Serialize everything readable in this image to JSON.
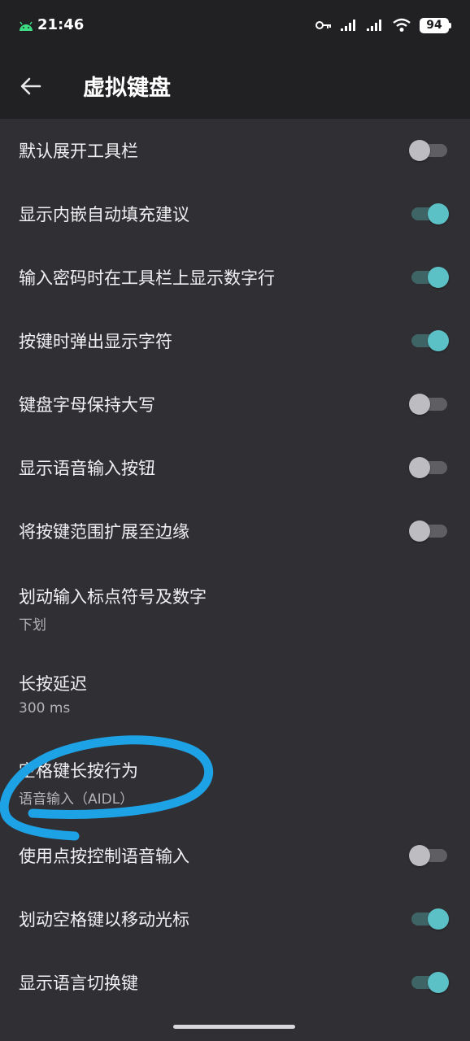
{
  "status_bar": {
    "time": "21:46",
    "battery": "94",
    "icons": [
      "android-icon",
      "key-icon",
      "signal-icon",
      "signal-icon",
      "wifi-icon",
      "battery-icon"
    ]
  },
  "app_bar": {
    "title": "虚拟键盘",
    "back_icon": "arrow-left-icon"
  },
  "colors": {
    "background": "#302f33",
    "bar": "#212023",
    "accent": "#5cc1c6",
    "annotation": "#1ea2e6"
  },
  "settings": [
    {
      "title": "默认展开工具栏",
      "type": "toggle",
      "on": false
    },
    {
      "title": "显示内嵌自动填充建议",
      "type": "toggle",
      "on": true
    },
    {
      "title": "输入密码时在工具栏上显示数字行",
      "type": "toggle",
      "on": true
    },
    {
      "title": "按键时弹出显示字符",
      "type": "toggle",
      "on": true
    },
    {
      "title": "键盘字母保持大写",
      "type": "toggle",
      "on": false
    },
    {
      "title": "显示语音输入按钮",
      "type": "toggle",
      "on": false
    },
    {
      "title": "将按键范围扩展至边缘",
      "type": "toggle",
      "on": false
    },
    {
      "title": "划动输入标点符号及数字",
      "type": "value",
      "value": "下划"
    },
    {
      "title": "长按延迟",
      "type": "value",
      "value": "300 ms"
    },
    {
      "title": "空格键长按行为",
      "type": "value",
      "value": "语音输入（AIDL）"
    },
    {
      "title": "使用点按控制语音输入",
      "type": "toggle",
      "on": false
    },
    {
      "title": "划动空格键以移动光标",
      "type": "toggle",
      "on": true
    },
    {
      "title": "显示语言切换键",
      "type": "toggle",
      "on": true
    }
  ]
}
